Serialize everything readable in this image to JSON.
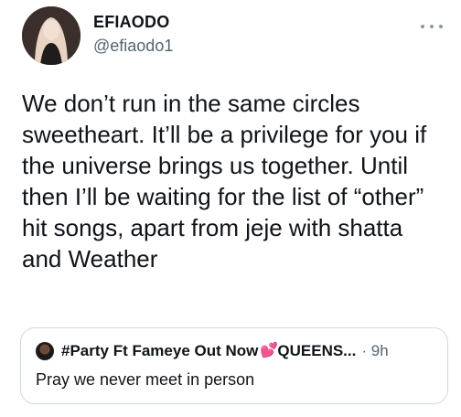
{
  "author": {
    "name": "EFIAODO",
    "handle": "@efiaodo1"
  },
  "tweet": {
    "lines": [
      "We don’t run in the same circles",
      "sweetheart. It’ll be a privilege for you if",
      "the universe brings us together. Until",
      "then I’ll be waiting for the list of “other”",
      "hit songs, apart from jeje with shatta",
      "and Weather"
    ]
  },
  "quote": {
    "name_part1": "#Party Ft Fameye Out Now",
    "name_emoji": "💕",
    "name_part2": "QUEENS...",
    "time": "· 9h",
    "text": "Pray we never meet in person"
  },
  "icons": {
    "more": "more-horizontal-icon",
    "heart": "heart-emoji-icon"
  },
  "colors": {
    "text": "#0f1419",
    "secondary": "#536471",
    "border": "#cfd9de"
  }
}
